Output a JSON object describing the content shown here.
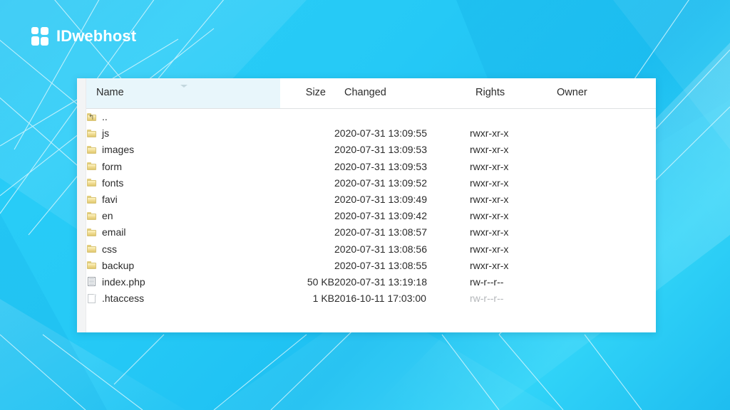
{
  "brand": {
    "name": "IDwebhost",
    "icon": "four-squares-logo-icon",
    "color": "#ffffff"
  },
  "background": {
    "type": "cyan-gradient-with-light-rays",
    "colors": [
      "#1fc4f4",
      "#28ccf7",
      "#1ebdf0",
      "#31d4f8"
    ]
  },
  "file_manager": {
    "sorted_column": "Name",
    "sort_direction": "ascending",
    "columns": [
      {
        "key": "name",
        "label": "Name",
        "align": "left"
      },
      {
        "key": "size",
        "label": "Size",
        "align": "right"
      },
      {
        "key": "changed",
        "label": "Changed",
        "align": "left"
      },
      {
        "key": "rights",
        "label": "Rights",
        "align": "left"
      },
      {
        "key": "owner",
        "label": "Owner",
        "align": "left"
      }
    ],
    "rows": [
      {
        "icon": "folder-up-icon",
        "name": "..",
        "size": "",
        "changed": "",
        "rights": "",
        "owner": "",
        "dim": false
      },
      {
        "icon": "folder-icon",
        "name": "js",
        "size": "",
        "changed": "2020-07-31 13:09:55",
        "rights": "rwxr-xr-x",
        "owner": "",
        "dim": false
      },
      {
        "icon": "folder-icon",
        "name": "images",
        "size": "",
        "changed": "2020-07-31 13:09:53",
        "rights": "rwxr-xr-x",
        "owner": "",
        "dim": false
      },
      {
        "icon": "folder-icon",
        "name": "form",
        "size": "",
        "changed": "2020-07-31 13:09:53",
        "rights": "rwxr-xr-x",
        "owner": "",
        "dim": false
      },
      {
        "icon": "folder-icon",
        "name": "fonts",
        "size": "",
        "changed": "2020-07-31 13:09:52",
        "rights": "rwxr-xr-x",
        "owner": "",
        "dim": false
      },
      {
        "icon": "folder-icon",
        "name": "favi",
        "size": "",
        "changed": "2020-07-31 13:09:49",
        "rights": "rwxr-xr-x",
        "owner": "",
        "dim": false
      },
      {
        "icon": "folder-icon",
        "name": "en",
        "size": "",
        "changed": "2020-07-31 13:09:42",
        "rights": "rwxr-xr-x",
        "owner": "",
        "dim": false
      },
      {
        "icon": "folder-icon",
        "name": "email",
        "size": "",
        "changed": "2020-07-31 13:08:57",
        "rights": "rwxr-xr-x",
        "owner": "",
        "dim": false
      },
      {
        "icon": "folder-icon",
        "name": "css",
        "size": "",
        "changed": "2020-07-31 13:08:56",
        "rights": "rwxr-xr-x",
        "owner": "",
        "dim": false
      },
      {
        "icon": "folder-icon",
        "name": "backup",
        "size": "",
        "changed": "2020-07-31 13:08:55",
        "rights": "rwxr-xr-x",
        "owner": "",
        "dim": false
      },
      {
        "icon": "document-icon",
        "name": "index.php",
        "size": "50 KB",
        "changed": "2020-07-31 13:19:18",
        "rights": "rw-r--r--",
        "owner": "",
        "dim": false
      },
      {
        "icon": "blank-file-icon",
        "name": ".htaccess",
        "size": "1 KB",
        "changed": "2016-10-11 17:03:00",
        "rights": "rw-r--r--",
        "owner": "",
        "dim": true
      }
    ]
  }
}
